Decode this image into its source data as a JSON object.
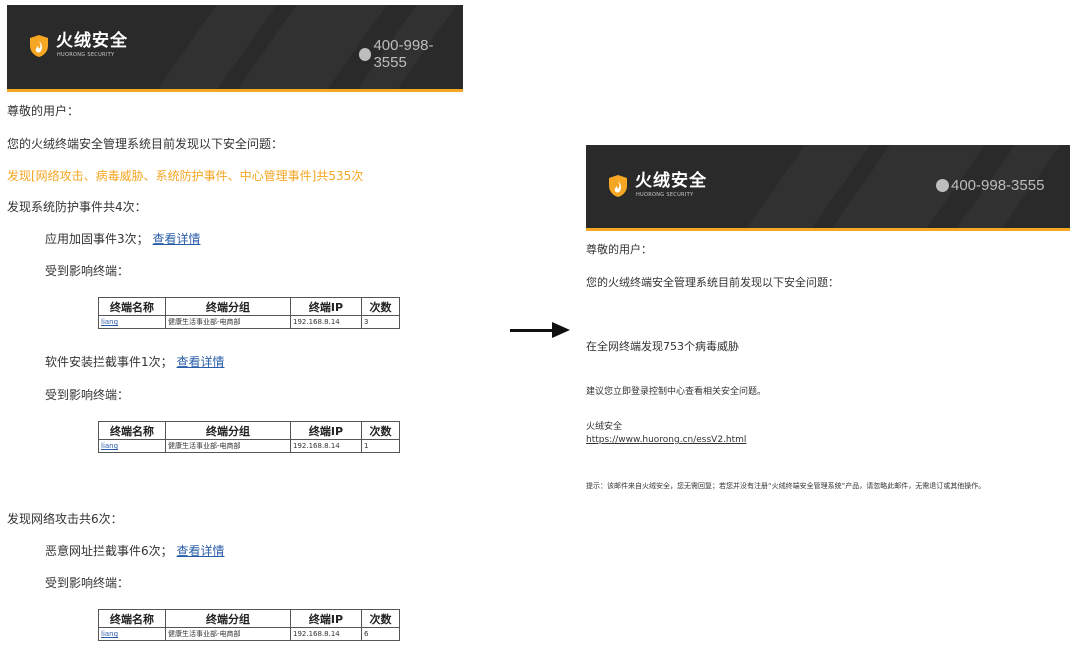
{
  "left": {
    "header": {
      "logo_name": "火绒安全",
      "logo_sub": "HUORONG SECURITY",
      "phone": "400-998-3555"
    },
    "greeting": "尊敬的用户：",
    "intro": "您的火绒终端安全管理系统目前发现以下安全问题：",
    "summary": "发现[网络攻击、病毒威胁、系统防护事件、中心管理事件]共535次",
    "sys_section": "发现系统防护事件共4次：",
    "event1": {
      "label": "应用加固事件3次；",
      "link": "查看详情"
    },
    "affected_label": "受到影响终端：",
    "table_headers": [
      "终端名称",
      "终端分组",
      "终端IP",
      "次数"
    ],
    "table1": {
      "name": "liang",
      "group": "健康生活事业部-电商部",
      "ip": "192.168.8.14",
      "count": "3"
    },
    "event2": {
      "label": "软件安装拦截事件1次；",
      "link": "查看详情"
    },
    "table2": {
      "name": "liang",
      "group": "健康生活事业部-电商部",
      "ip": "192.168.8.14",
      "count": "1"
    },
    "net_section": "发现网络攻击共6次：",
    "event3": {
      "label": "恶意网址拦截事件6次；",
      "link": "查看详情"
    },
    "table3": {
      "name": "liang",
      "group": "健康生活事业部-电商部",
      "ip": "192.168.8.14",
      "count": "6"
    }
  },
  "right": {
    "header": {
      "logo_name": "火绒安全",
      "logo_sub": "HUORONG SECURITY",
      "phone": "400-998-3555"
    },
    "greeting": "尊敬的用户：",
    "intro": "您的火绒终端安全管理系统目前发现以下安全问题：",
    "virus_alert": "在全网终端发现753个病毒威胁",
    "suggestion": "建议您立即登录控制中心查看相关安全问题。",
    "signature": "火绒安全",
    "url": "https://www.huorong.cn/essV2.html",
    "notice": "提示：该邮件来自火绒安全，您无需回复；若您并没有注册“火绒终端安全管理系统”产品，请忽略此邮件，无需退订或其他操作。"
  },
  "colors": {
    "header_bg": "#2a2a2a",
    "accent": "#f5a623",
    "link": "#2a5da8"
  },
  "icons": [
    "shield-logo-icon",
    "phone-icon",
    "arrow-right-icon"
  ]
}
